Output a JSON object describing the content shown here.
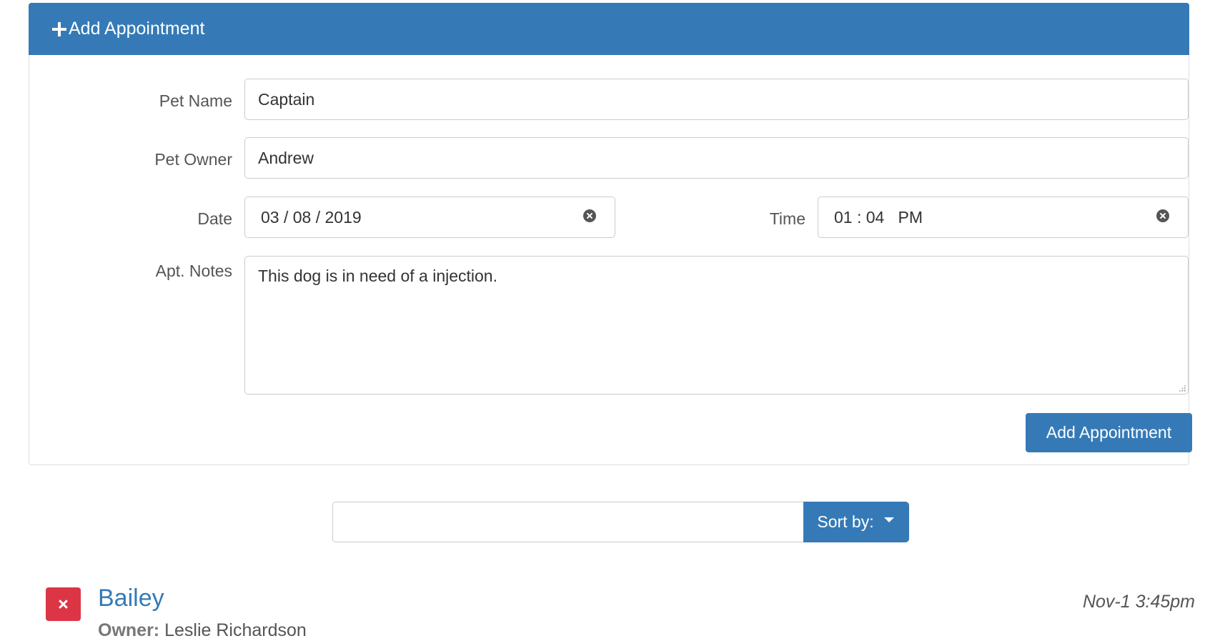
{
  "form": {
    "header_title": "Add Appointment",
    "pet_name_label": "Pet Name",
    "pet_name_value": "Captain",
    "pet_owner_label": "Pet Owner",
    "pet_owner_value": "Andrew",
    "date_label": "Date",
    "date_value": "03 / 08 / 2019",
    "time_label": "Time",
    "time_value": "01 : 04   PM",
    "notes_label": "Apt. Notes",
    "notes_value": "This dog is in need of a injection.",
    "submit_label": "Add Appointment"
  },
  "search": {
    "placeholder": "",
    "sort_label": "Sort by:"
  },
  "appointments": [
    {
      "pet_name": "Bailey",
      "owner_label": "Owner:",
      "owner_name": "Leslie Richardson",
      "date": "Nov-1 3:45pm"
    }
  ],
  "colors": {
    "primary": "#357ab7",
    "danger": "#dc3545"
  },
  "icons": {
    "header": "plus-icon",
    "clear": "clear-icon",
    "sort": "caret-down-icon",
    "delete": "close-icon"
  }
}
